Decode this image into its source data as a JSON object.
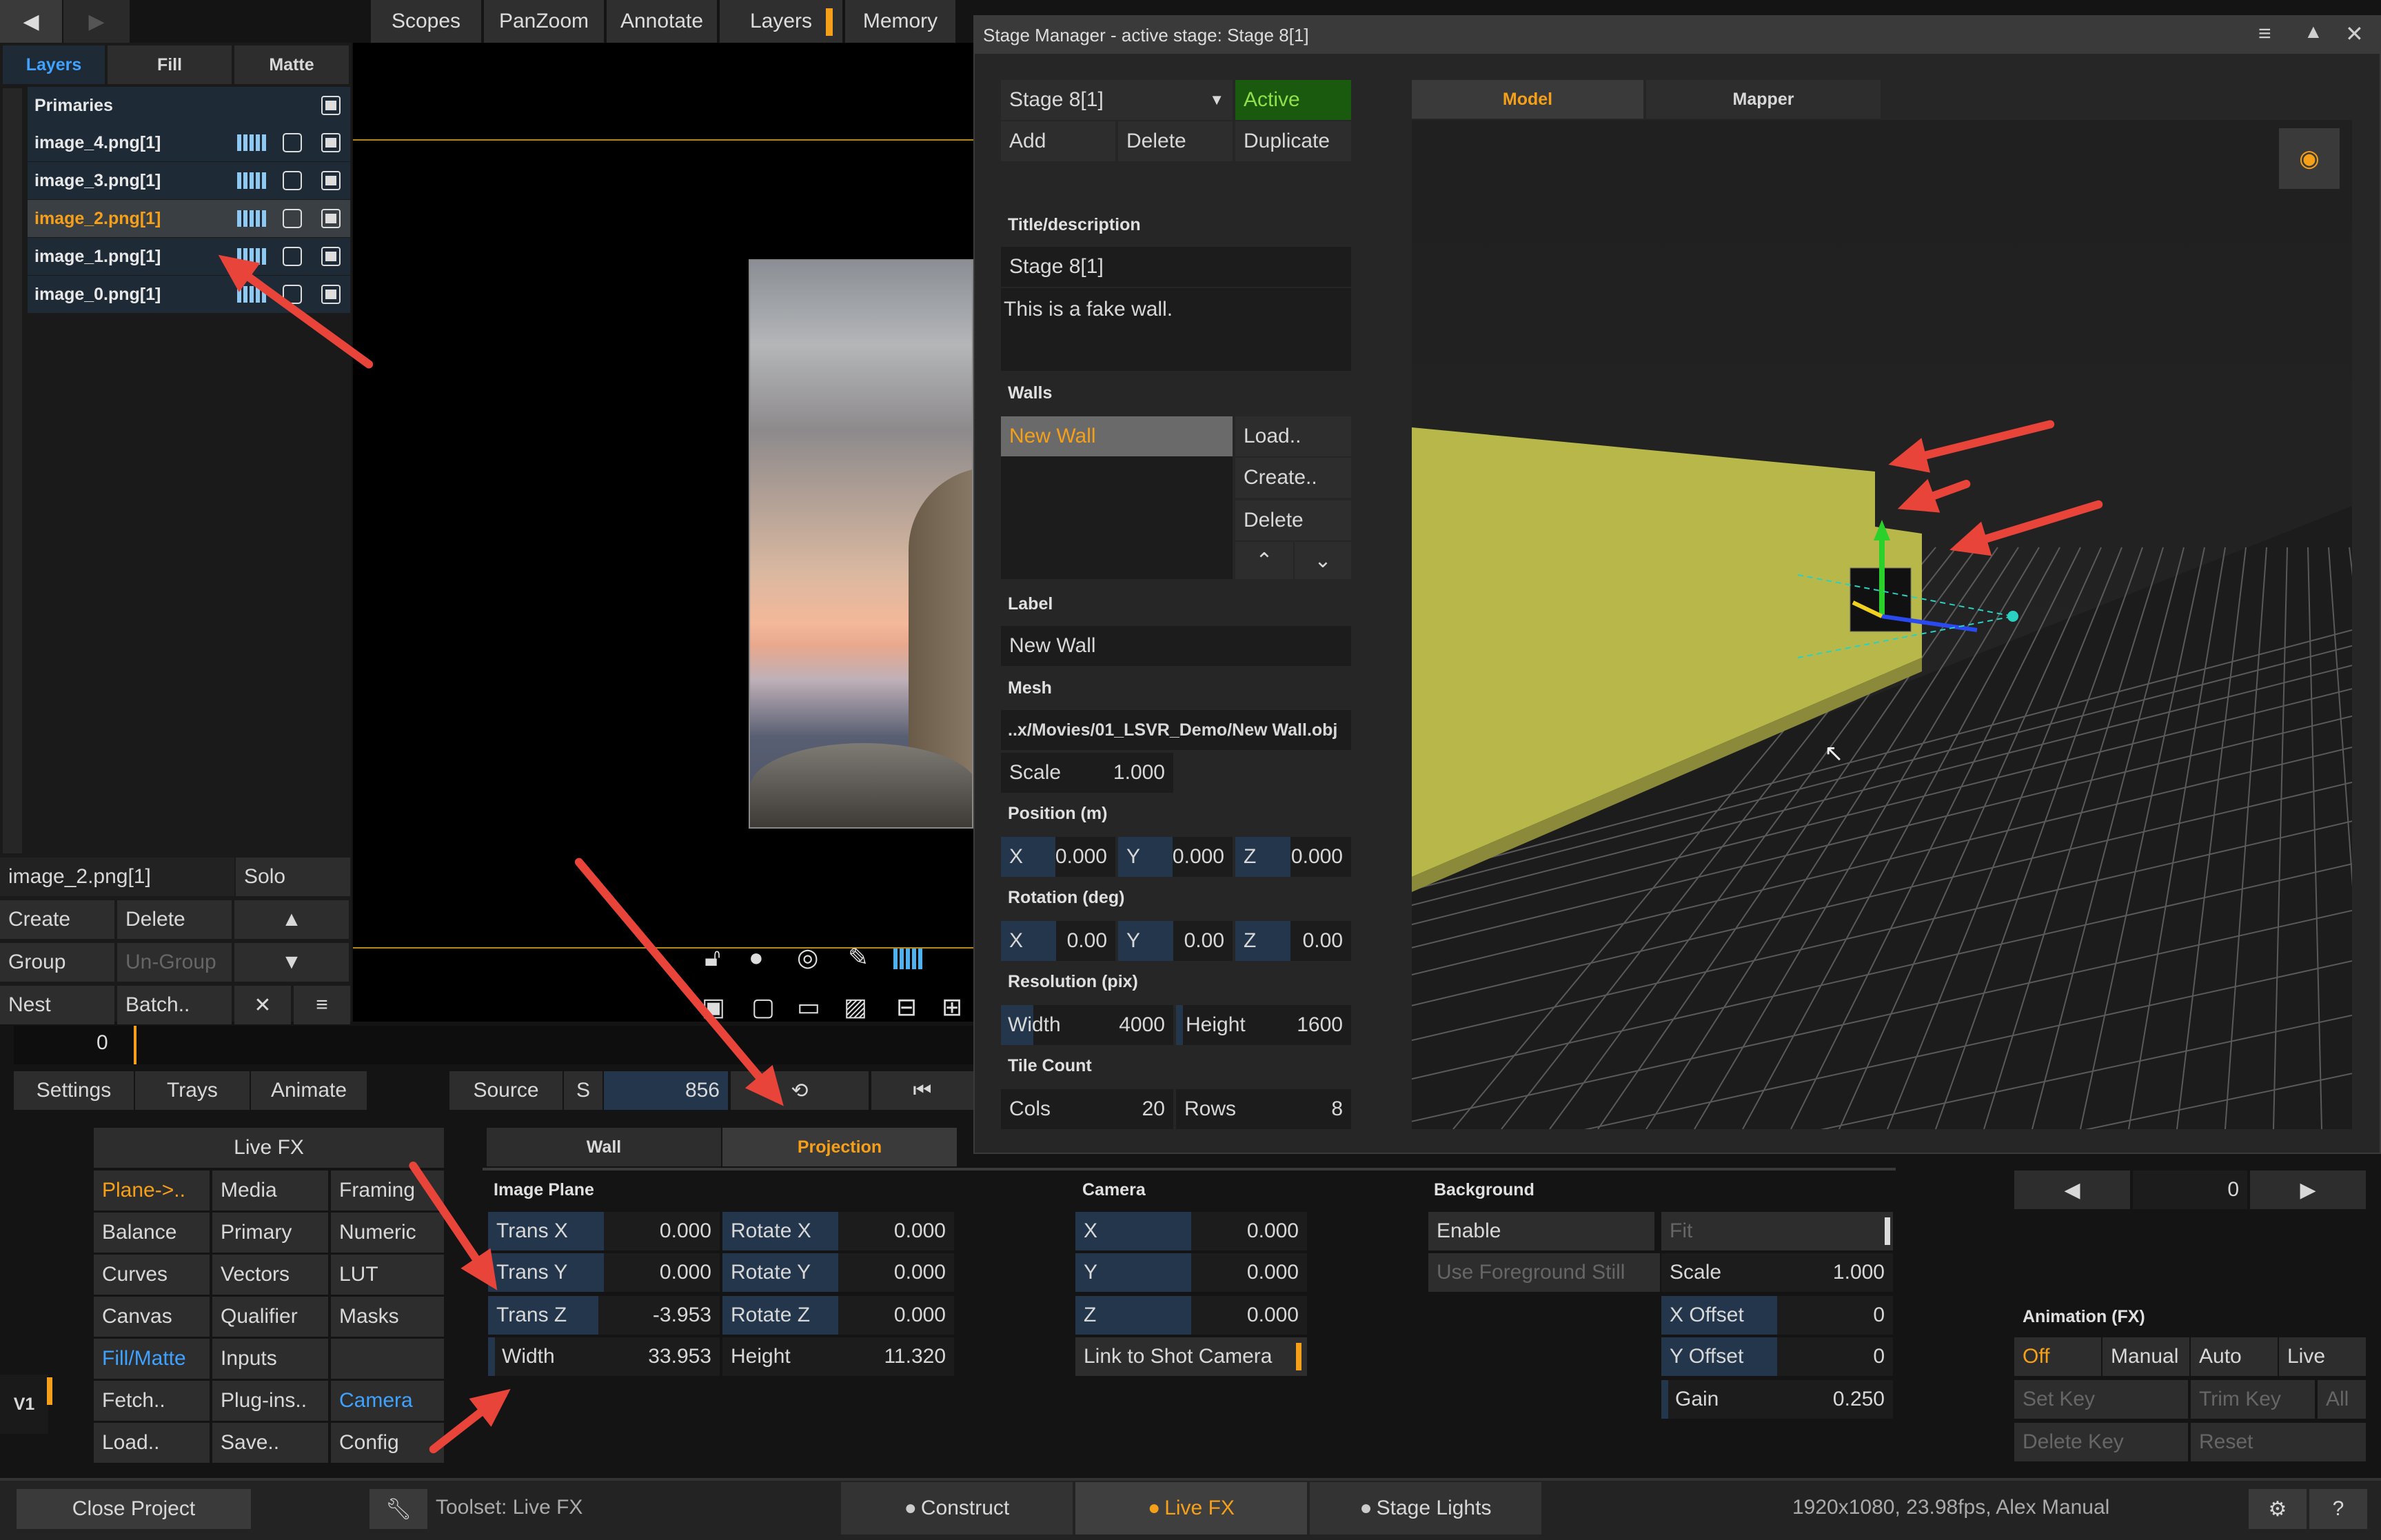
{
  "top_nav": {
    "back": "◀",
    "forward": "▶",
    "tabs": [
      "Scopes",
      "PanZoom",
      "Annotate",
      "Layers",
      "Memory"
    ]
  },
  "layers_panel": {
    "tabs": [
      "Layers",
      "Fill",
      "Matte"
    ],
    "primaries_label": "Primaries",
    "items": [
      "image_4.png[1]",
      "image_3.png[1]",
      "image_2.png[1]",
      "image_1.png[1]",
      "image_0.png[1]"
    ],
    "selected_name": "image_2.png[1]",
    "solo": "Solo",
    "buttons": {
      "create": "Create",
      "delete": "Delete",
      "group": "Group",
      "ungroup": "Un-Group",
      "nest": "Nest",
      "batch": "Batch.."
    }
  },
  "timeline": {
    "frame": "0",
    "source_label": "Source",
    "s_label": "S",
    "source_frame": "856"
  },
  "bottom_tabs": {
    "settings": "Settings",
    "trays": "Trays",
    "animate": "Animate"
  },
  "live_fx": {
    "title": "Live FX",
    "grid": [
      [
        "Plane->..",
        "Media",
        "Framing"
      ],
      [
        "Balance",
        "Primary",
        "Numeric"
      ],
      [
        "Curves",
        "Vectors",
        "LUT"
      ],
      [
        "Canvas",
        "Qualifier",
        "Masks"
      ],
      [
        "Fill/Matte",
        "Inputs",
        ""
      ],
      [
        "Fetch..",
        "Plug-ins..",
        "Camera"
      ],
      [
        "Load..",
        "Save..",
        "Config"
      ]
    ],
    "track": "V1"
  },
  "projection": {
    "tabs": [
      "Wall",
      "Projection"
    ],
    "image_plane_label": "Image Plane",
    "trans_x": "Trans X",
    "trans_x_val": "0.000",
    "trans_y": "Trans Y",
    "trans_y_val": "0.000",
    "trans_z": "Trans Z",
    "trans_z_val": "-3.953",
    "width": "Width",
    "width_val": "33.953",
    "rot_x": "Rotate X",
    "rot_x_val": "0.000",
    "rot_y": "Rotate Y",
    "rot_y_val": "0.000",
    "rot_z": "Rotate Z",
    "rot_z_val": "0.000",
    "height": "Height",
    "height_val": "11.320"
  },
  "camera": {
    "label": "Camera",
    "x": "X",
    "y": "Y",
    "z": "Z",
    "x_val": "0.000",
    "y_val": "0.000",
    "z_val": "0.000",
    "link": "Link to Shot Camera"
  },
  "background": {
    "label": "Background",
    "enable": "Enable",
    "fit": "Fit",
    "use_fg": "Use Foreground Still",
    "scale": "Scale",
    "scale_val": "1.000",
    "x_offset": "X Offset",
    "x_offset_val": "0",
    "y_offset": "Y Offset",
    "y_offset_val": "0",
    "gain": "Gain",
    "gain_val": "0.250"
  },
  "animation": {
    "label": "Animation (FX)",
    "modes": [
      "Off",
      "Manual",
      "Auto",
      "Live"
    ],
    "set_key": "Set Key",
    "trim_key": "Trim Key",
    "all": "All",
    "delete_key": "Delete Key",
    "reset": "Reset",
    "frame_val": "0"
  },
  "status_bar": {
    "close_project": "Close Project",
    "toolset": "Toolset: Live FX",
    "tabs": [
      "Construct",
      "Live FX",
      "Stage Lights"
    ],
    "info": "1920x1080, 23.98fps, Alex Manual",
    "help": "?"
  },
  "stage_manager": {
    "title": "Stage Manager - active stage: Stage 8[1]",
    "stage_select": "Stage 8[1]",
    "active": "Active",
    "add": "Add",
    "delete": "Delete",
    "duplicate": "Duplicate",
    "title_desc_label": "Title/description",
    "title_value": "Stage 8[1]",
    "description": "This is a fake wall.",
    "walls_label": "Walls",
    "wall_item": "New Wall",
    "load": "Load..",
    "create": "Create..",
    "wall_delete": "Delete",
    "label_label": "Label",
    "label_value": "New Wall",
    "mesh_label": "Mesh",
    "mesh_path": "..x/Movies/01_LSVR_Demo/New Wall.obj",
    "scale_label": "Scale",
    "scale_val": "1.000",
    "position_label": "Position (m)",
    "px": "X",
    "px_val": "0.000",
    "py": "Y",
    "py_val": "0.000",
    "pz": "Z",
    "pz_val": "0.000",
    "rotation_label": "Rotation (deg)",
    "rx": "X",
    "rx_val": "0.00",
    "ry": "Y",
    "ry_val": "0.00",
    "rz": "Z",
    "rz_val": "0.00",
    "resolution_label": "Resolution (pix)",
    "res_width": "Width",
    "res_width_val": "4000",
    "res_height": "Height",
    "res_height_val": "1600",
    "tile_label": "Tile Count",
    "cols": "Cols",
    "cols_val": "20",
    "rows": "Rows",
    "rows_val": "8",
    "view_tabs": [
      "Model",
      "Mapper"
    ]
  },
  "colors": {
    "accent": "#f6a01a",
    "active_green": "#1a5a0f",
    "blue_link": "#3fa2ff",
    "wall_yellow": "#b8b84a"
  }
}
